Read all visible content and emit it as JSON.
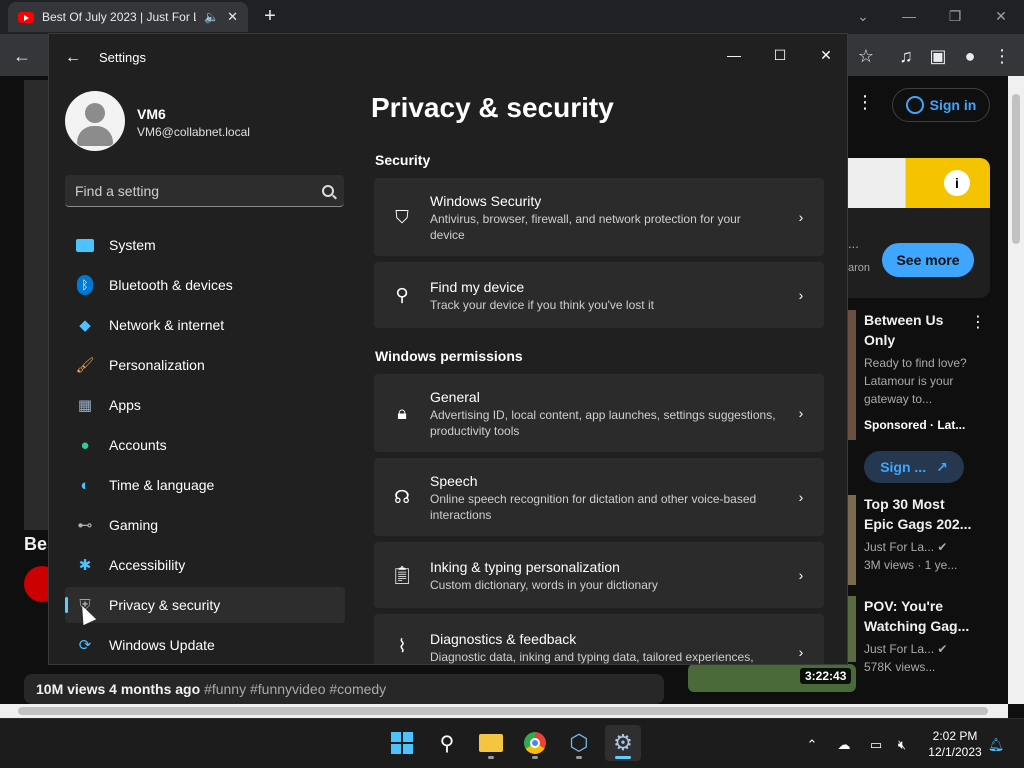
{
  "browser": {
    "tab_title": "Best Of July 2023 | Just For L",
    "window_controls": [
      "⌄",
      "—",
      "❐",
      "✕"
    ]
  },
  "youtube": {
    "sign_in": "Sign in",
    "see_more": "See more",
    "ad_partial": "...",
    "ad_partial2": "aron",
    "left_title_partial": "Bes",
    "recommendations": [
      {
        "title": "Between Us Only",
        "meta1": "Ready to find love? Latamour is your gateway to...",
        "meta2": "Sponsored · Lat..."
      },
      {
        "title": "Top 30 Most Epic Gags 202...",
        "meta1": "Just For La... ✔",
        "meta2": "3M views · 1 ye..."
      },
      {
        "title": "POV: You're Watching Gag...",
        "meta1": "Just For La... ✔",
        "meta2": "578K views..."
      }
    ],
    "sign_in_ad": "Sign ...",
    "duration": "3:22:43",
    "views": "10M views",
    "ago": "4 months ago",
    "tags": "#funny #funnyvideo #comedy"
  },
  "settings": {
    "window_title": "Settings",
    "user": {
      "name": "VM6",
      "email": "VM6@collabnet.local"
    },
    "search_placeholder": "Find a setting",
    "nav": [
      {
        "label": "System",
        "icon": "system-icon",
        "color": "#4cc2ff"
      },
      {
        "label": "Bluetooth & devices",
        "icon": "bluetooth-icon",
        "color": "#0078d4"
      },
      {
        "label": "Network & internet",
        "icon": "wifi-icon",
        "color": "#4cc2ff"
      },
      {
        "label": "Personalization",
        "icon": "brush-icon",
        "color": "#f0a050"
      },
      {
        "label": "Apps",
        "icon": "apps-icon",
        "color": "#9ab0c8"
      },
      {
        "label": "Accounts",
        "icon": "accounts-icon",
        "color": "#2ecc9a"
      },
      {
        "label": "Time & language",
        "icon": "globe-clock-icon",
        "color": "#4cc2ff"
      },
      {
        "label": "Gaming",
        "icon": "gamepad-icon",
        "color": "#b0b0b0"
      },
      {
        "label": "Accessibility",
        "icon": "accessibility-icon",
        "color": "#4cc2ff"
      },
      {
        "label": "Privacy & security",
        "icon": "shield-icon",
        "color": "#a0a0a0",
        "active": true
      },
      {
        "label": "Windows Update",
        "icon": "update-icon",
        "color": "#4cc2ff"
      }
    ],
    "page_title": "Privacy & security",
    "section_security": "Security",
    "section_permissions": "Windows permissions",
    "cards": [
      {
        "title": "Windows Security",
        "desc": "Antivirus, browser, firewall, and network protection for your device",
        "icon": "shield-outline-icon"
      },
      {
        "title": "Find my device",
        "desc": "Track your device if you think you've lost it",
        "icon": "person-pin-icon"
      },
      {
        "title": "General",
        "desc": "Advertising ID, local content, app launches, settings suggestions, productivity tools",
        "icon": "lock-icon"
      },
      {
        "title": "Speech",
        "desc": "Online speech recognition for dictation and other voice-based interactions",
        "icon": "speech-icon"
      },
      {
        "title": "Inking & typing personalization",
        "desc": "Custom dictionary, words in your dictionary",
        "icon": "clipboard-icon"
      },
      {
        "title": "Diagnostics & feedback",
        "desc": "Diagnostic data, inking and typing data, tailored experiences,",
        "icon": "diagnostics-icon"
      }
    ]
  },
  "taskbar": {
    "time": "2:02 PM",
    "date": "12/1/2023"
  }
}
